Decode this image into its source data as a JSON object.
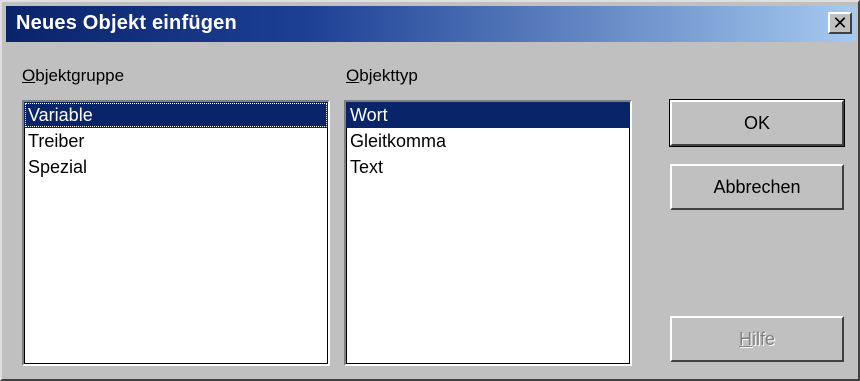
{
  "window": {
    "title": "Neues Objekt einfügen",
    "close_glyph": "✕"
  },
  "objektgruppe": {
    "label_accel": "O",
    "label_rest": "bjektgruppe",
    "items": [
      "Variable",
      "Treiber",
      "Spezial"
    ],
    "selected": "Variable"
  },
  "objekttyp": {
    "label_accel": "O",
    "label_rest": "bjekttyp",
    "items": [
      "Wort",
      "Gleitkomma",
      "Text"
    ],
    "selected": "Wort"
  },
  "buttons": {
    "ok": "OK",
    "cancel": "Abbrechen",
    "help_accel": "H",
    "help_rest": "ilfe"
  },
  "colors": {
    "face": "#c0c0c0",
    "title_start": "#0a246a",
    "title_end": "#a6caf0",
    "selection": "#0a246a"
  }
}
